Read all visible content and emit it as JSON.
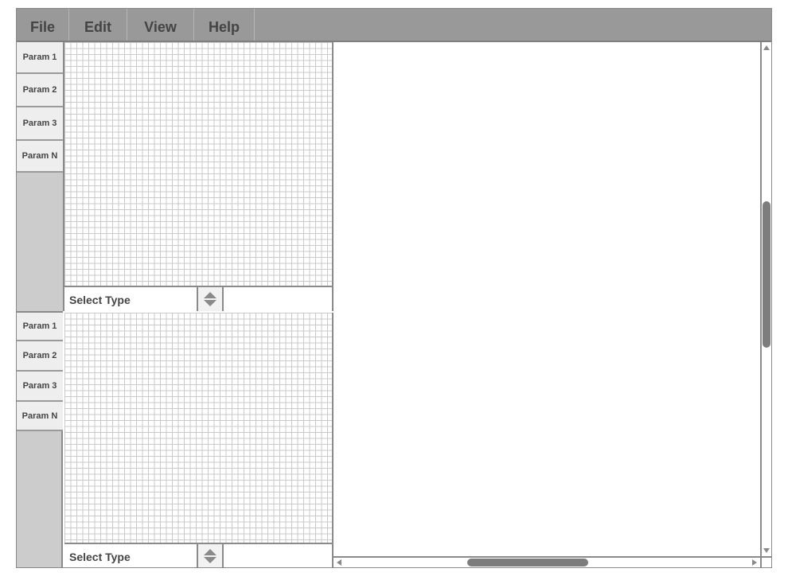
{
  "menubar": {
    "items": [
      {
        "label": "File"
      },
      {
        "label": "Edit"
      },
      {
        "label": "View"
      },
      {
        "label": "Help"
      }
    ]
  },
  "panels": [
    {
      "params": [
        "Param 1",
        "Param 2",
        "Param 3",
        "Param N"
      ],
      "select_label": "Select Type"
    },
    {
      "params": [
        "Param 1",
        "Param 2",
        "Param 3",
        "Param N"
      ],
      "select_label": "Select Type"
    }
  ],
  "icons": {
    "spinner": "up-down-spinner-icon",
    "scroll_up": "scroll-up-arrow-icon",
    "scroll_down": "scroll-down-arrow-icon",
    "scroll_left": "scroll-left-arrow-icon",
    "scroll_right": "scroll-right-arrow-icon"
  },
  "colors": {
    "menubar_bg": "#999999",
    "param_bg": "#eeeeee",
    "sidebar_bg": "#cccccc",
    "grid_line": "#c9c9c9",
    "scroll_thumb": "#7d7d7d"
  }
}
